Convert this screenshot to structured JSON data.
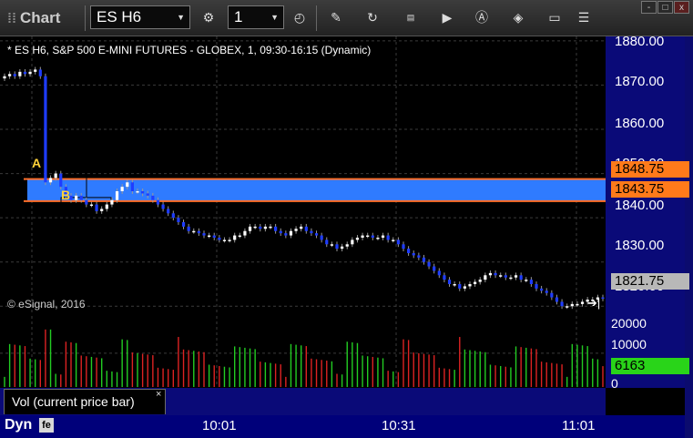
{
  "toolbar": {
    "title": "Chart",
    "symbol": "ES H6",
    "interval": "1",
    "icons": [
      "settings-icon",
      "clock-icon",
      "pencil-icon",
      "refresh-icon",
      "get-icon",
      "play-icon",
      "a-icon",
      "eraser-icon",
      "comment-icon",
      "menu-icon"
    ]
  },
  "window": {
    "minimize": "-",
    "maximize": "□",
    "close": "x"
  },
  "chart": {
    "description": "* ES H6, S&P 500 E-MINI FUTURES - GLOBEX, 1, 09:30-16:15 (Dynamic)",
    "copyright": "© eSignal, 2016",
    "zone_label_a": "A",
    "zone_label_b": "B",
    "colors": {
      "up": "#ffffff",
      "down": "#1e3cff",
      "zone": "#2f7bff",
      "zone_line": "#ff6f2a",
      "grid": "#3a3a3a"
    }
  },
  "price_axis": {
    "labels": [
      "1880.00",
      "1870.00",
      "1860.00",
      "1850.00",
      "1840.00",
      "1830.00",
      "1820.00"
    ],
    "tag_upper": "1848.75",
    "tag_lower": "1843.75",
    "tag_last": "1821.75"
  },
  "volume_axis": {
    "top": "20000",
    "mid": "10000",
    "zero": "0",
    "current": "6163"
  },
  "legend": {
    "study": "Vol (current price bar)",
    "close": "×"
  },
  "time_axis": {
    "mode": "Dyn",
    "mode_icon": "fe",
    "labels": [
      "10:01",
      "10:31",
      "11:01"
    ]
  },
  "chart_data": {
    "type": "candlestick",
    "symbol": "ES H6",
    "interval": "1 min",
    "price_ylim": [
      1818,
      1881
    ],
    "zone": {
      "upper": 1848.75,
      "lower": 1843.75
    },
    "last_price": 1821.75,
    "close_series": [
      1872,
      1872.5,
      1872,
      1873,
      1872.5,
      1873,
      1873.5,
      1872,
      1848,
      1849,
      1850,
      1847,
      1845,
      1844,
      1845,
      1844,
      1843,
      1843,
      1841.5,
      1842,
      1843,
      1844,
      1846,
      1847,
      1848,
      1846,
      1846,
      1845.5,
      1845,
      1844,
      1843,
      1842,
      1841,
      1840,
      1839,
      1838,
      1837,
      1837,
      1836.5,
      1836,
      1836,
      1835.5,
      1835,
      1835,
      1835,
      1836,
      1836,
      1837,
      1838,
      1838,
      1837.5,
      1838,
      1838,
      1837,
      1836.5,
      1836,
      1837,
      1837.5,
      1838,
      1837,
      1836.5,
      1836,
      1835,
      1834,
      1834,
      1833,
      1833.5,
      1834,
      1835,
      1835.5,
      1836,
      1836,
      1835.5,
      1835.5,
      1836,
      1835,
      1835,
      1834,
      1833,
      1832,
      1831.5,
      1831,
      1830,
      1829,
      1828,
      1827,
      1826,
      1825,
      1825,
      1824,
      1824.5,
      1825,
      1825.5,
      1826,
      1827,
      1827.5,
      1827,
      1827,
      1826.5,
      1826.5,
      1827,
      1826,
      1826,
      1825,
      1824,
      1823.5,
      1823,
      1822,
      1821,
      1820,
      1820,
      1820.5,
      1820.5,
      1821,
      1821.5,
      1821.5,
      1822,
      1821.75
    ],
    "volume_ylim": [
      0,
      21000
    ],
    "current_volume": 6163
  }
}
